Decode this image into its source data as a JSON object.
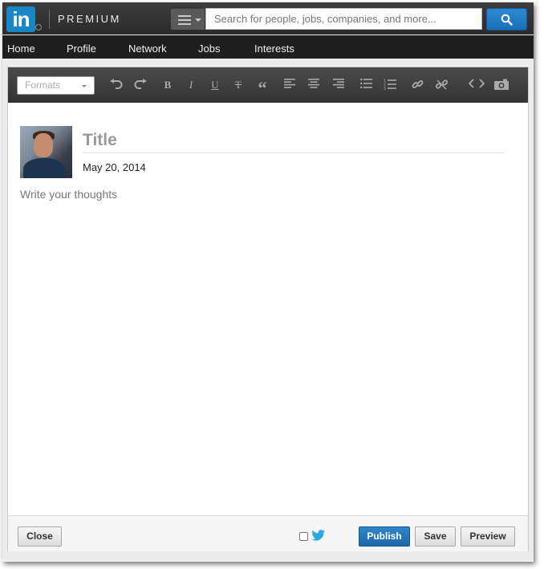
{
  "header": {
    "logo_text": "in",
    "premium_label": "PREMIUM",
    "search": {
      "placeholder": "Search for people, jobs, companies, and more..."
    }
  },
  "nav": {
    "items": [
      {
        "label": "Home"
      },
      {
        "label": "Profile"
      },
      {
        "label": "Network"
      },
      {
        "label": "Jobs"
      },
      {
        "label": "Interests"
      }
    ]
  },
  "toolbar": {
    "formats_label": "Formats",
    "tools": [
      "undo-icon",
      "redo-icon",
      "bold-icon",
      "italic-icon",
      "underline-icon",
      "strikethrough-icon",
      "blockquote-icon",
      "align-left-icon",
      "align-center-icon",
      "align-right-icon",
      "bullet-list-icon",
      "numbered-list-icon",
      "link-icon",
      "unlink-icon",
      "code-icon",
      "camera-icon"
    ]
  },
  "post": {
    "title_placeholder": "Title",
    "date": "May 20, 2014",
    "body_placeholder": "Write your thoughts"
  },
  "footer": {
    "close_label": "Close",
    "publish_label": "Publish",
    "save_label": "Save",
    "preview_label": "Preview"
  },
  "colors": {
    "brand": "#1b86c5",
    "primary_button": "#1f6db0",
    "twitter": "#2ea9e0"
  }
}
